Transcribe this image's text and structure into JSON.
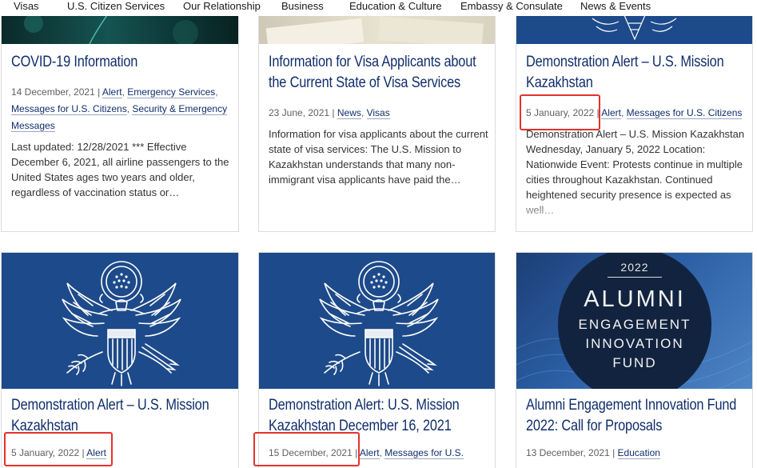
{
  "nav": [
    {
      "label": "Visas"
    },
    {
      "label": "U.S. Citizen Services"
    },
    {
      "label": "Our Relationship"
    },
    {
      "label": "Business"
    },
    {
      "label": "Education & Culture"
    },
    {
      "label": "Embassy & Consulate"
    },
    {
      "label": "News & Events"
    }
  ],
  "cards": [
    {
      "title": "COVID-19 Information",
      "date": "14 December, 2021",
      "separator": " | ",
      "tags": [
        "Alert",
        "Emergency Services",
        "Messages for U.S. Citizens",
        "Security & Emergency Messages"
      ],
      "excerpt": "Last updated:   12/28/2021 *** Effective December 6, 2021, all airline passengers to the United States ages two years and older, regardless of vaccination status or…"
    },
    {
      "title": "Information for Visa Applicants about the Current State of Visa Services",
      "date": "23 June, 2021",
      "separator": " | ",
      "tags": [
        "News",
        "Visas"
      ],
      "excerpt": "Information for visa applicants about the current state of visa services:  The U.S. Mission to Kazakhstan understands that many non-immigrant visa applicants have paid the…"
    },
    {
      "title": "Demonstration Alert – U.S. Mission Kazakhstan",
      "date": "5 January, 2022",
      "separator": " | ",
      "tags": [
        "Alert",
        "Messages for U.S. Citizens"
      ],
      "excerpt": "Demonstration Alert – U.S. Mission Kazakhstan Wednesday, January 5, 2022 Location:  Nationwide Event: Protests continue in multiple cities throughout Kazakhstan. Continued heightened security presence is expected as well…"
    },
    {
      "title": "Demonstration Alert – U.S. Mission Kazakhstan",
      "date": "5 January, 2022",
      "separator": " | ",
      "tags": [
        "Alert"
      ]
    },
    {
      "title": "Demonstration Alert: U.S. Mission Kazakhstan December 16, 2021",
      "date": "15 December, 2021",
      "separator": " | ",
      "tags": [
        "Alert",
        "Messages for U.S."
      ]
    },
    {
      "title": "Alumni Engagement Innovation Fund 2022: Call for Proposals",
      "date": "13 December, 2021",
      "separator": " | ",
      "tags": [
        "Education"
      ]
    }
  ],
  "alumni_image": {
    "year": "2022",
    "line1": "ALUMNI",
    "line2": "ENGAGEMENT",
    "line3": "INNOVATION",
    "line4": "FUND"
  },
  "colors": {
    "title": "#102e6b",
    "seal_bg": "#1d4a8a",
    "highlight": "#e5322d"
  }
}
